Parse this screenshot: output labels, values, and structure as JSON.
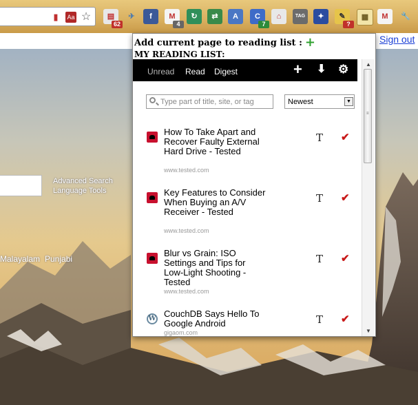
{
  "omnibox": {
    "icons": [
      "bookmark-icon",
      "dictionary-icon",
      "star-icon"
    ]
  },
  "extensions": [
    {
      "name": "pdf-extension-icon",
      "badge": "62",
      "badge_color": "#c0302a"
    },
    {
      "name": "bird-extension-icon",
      "badge": "",
      "badge_color": ""
    },
    {
      "name": "facebook-icon",
      "badge": "",
      "badge_color": ""
    },
    {
      "name": "gmail-checker-icon",
      "badge": "4",
      "badge_color": "#666666"
    },
    {
      "name": "refresh-extension-icon",
      "badge": "",
      "badge_color": ""
    },
    {
      "name": "sync-extension-icon",
      "badge": "",
      "badge_color": ""
    },
    {
      "name": "translate-icon",
      "badge": "",
      "badge_color": ""
    },
    {
      "name": "calendar-extension-icon",
      "badge": "7",
      "badge_color": "#2e8b3a"
    },
    {
      "name": "acrobat-icon",
      "badge": "",
      "badge_color": ""
    },
    {
      "name": "tag-icon",
      "badge": "",
      "badge_color": ""
    },
    {
      "name": "tools-extension-icon",
      "badge": "",
      "badge_color": ""
    },
    {
      "name": "notes-extension-icon",
      "badge": "?",
      "badge_color": "#c0302a"
    },
    {
      "name": "reading-list-icon",
      "badge": "",
      "badge_color": ""
    },
    {
      "name": "gmail-icon",
      "badge": "",
      "badge_color": ""
    },
    {
      "name": "wrench-icon",
      "badge": "",
      "badge_color": ""
    }
  ],
  "page": {
    "signout": "Sign out",
    "advanced_search": "Advanced Search",
    "language_tools": "Language Tools",
    "languages": [
      "Malayalam",
      "Punjabi"
    ]
  },
  "popup": {
    "add_current": "Add current page to reading list :",
    "my_list": "MY READING LIST:",
    "tabs": [
      "Unread",
      "Read",
      "Digest"
    ],
    "filter_placeholder": "Type part of title, site, or tag",
    "sort": "Newest",
    "items": [
      {
        "title": "How To Take Apart and Recover Faulty External Hard Drive - Tested",
        "site": "www.tested.com",
        "icon": "tested-favicon"
      },
      {
        "title": "Key Features to Consider When Buying an A/V Receiver - Tested",
        "site": "www.tested.com",
        "icon": "tested-favicon"
      },
      {
        "title": "Blur vs Grain: ISO Settings and Tips for Low-Light Shooting - Tested",
        "site": "www.tested.com",
        "icon": "tested-favicon"
      },
      {
        "title": "CouchDB Says Hello To Google Android",
        "site": "gigaom.com",
        "icon": "wordpress-favicon"
      }
    ],
    "text_button": "T",
    "check_mark": "✔"
  }
}
